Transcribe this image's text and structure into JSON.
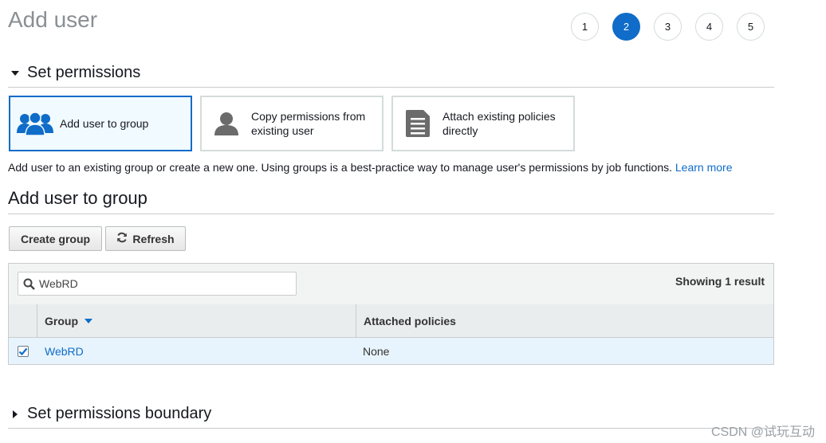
{
  "page": {
    "title": "Add user"
  },
  "steps": [
    "1",
    "2",
    "3",
    "4",
    "5"
  ],
  "active_step": "2",
  "permissions": {
    "heading": "Set permissions",
    "options": [
      {
        "label": "Add user to group",
        "icon": "users-group-icon",
        "selected": true
      },
      {
        "label": "Copy permissions from existing user",
        "icon": "user-icon",
        "selected": false
      },
      {
        "label": "Attach existing policies directly",
        "icon": "document-icon",
        "selected": false
      }
    ],
    "description": "Add user to an existing group or create a new one. Using groups is a best-practice way to manage user's permissions by job functions.",
    "learn_more": "Learn more"
  },
  "group_section": {
    "title": "Add user to group",
    "create_button": "Create group",
    "refresh_button": "Refresh",
    "search": {
      "value": "WebRD",
      "placeholder": ""
    },
    "result_count": "Showing 1 result",
    "columns": [
      "Group",
      "Attached policies"
    ],
    "rows": [
      {
        "group": "WebRD",
        "policies": "None",
        "checked": true
      }
    ]
  },
  "boundary": {
    "heading": "Set permissions boundary"
  },
  "watermark": "CSDN @试玩互动",
  "colors": {
    "accent": "#0f6cc8",
    "selected_bg": "#f1faff",
    "row_selected_bg": "#e7f4fd"
  }
}
